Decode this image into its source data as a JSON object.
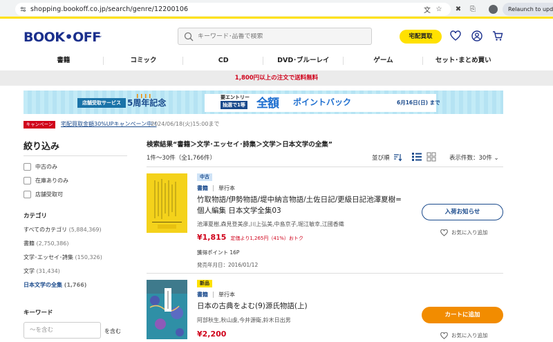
{
  "browser": {
    "url": "shopping.bookoff.co.jp/search/genre/12200106",
    "relaunch_label": "Relaunch to update"
  },
  "header": {
    "logo": "BOOK•OFF",
    "search_placeholder": "キーワード･品番で検索",
    "takuhai_label": "宅配買取"
  },
  "nav": {
    "items": [
      "書籍",
      "コミック",
      "CD",
      "DVD･ブルーレイ",
      "ゲーム",
      "セット･まとめ買い"
    ]
  },
  "shipping_notice": "1,800円以上の注文で送料無料",
  "banner": {
    "left_box": "店舗受取サービス",
    "anniv": "5周年記念",
    "entry_top": "要エントリー",
    "entry_bottom": "抽選で1等",
    "big_text": "全額",
    "big_text2": "ポイントバック",
    "date": "6月16日(日) まで"
  },
  "campaign": {
    "tag": "キャンペーン",
    "link": "宅配買取金額30%UPキャンペーン中!!",
    "date": "2024/06/18(火)15:00まで"
  },
  "sidebar": {
    "title": "絞り込み",
    "filters": [
      "中古のみ",
      "在庫ありのみ",
      "店舗受取可"
    ],
    "category_head": "カテゴリ",
    "categories": [
      {
        "label": "すべてのカテゴリ",
        "count": "(5,884,369)"
      },
      {
        "label": "書籍",
        "count": "(2,750,386)"
      },
      {
        "label": "文学･エッセイ･詩集",
        "count": "(150,326)"
      },
      {
        "label": "文学",
        "count": "(31,434)"
      },
      {
        "label": "日本文学の全集",
        "count": "(1,766)"
      }
    ],
    "keyword_head": "キーワード",
    "keyword_placeholder": "～を含む",
    "keyword_suffix": "を含む"
  },
  "results": {
    "title": "検索結果“書籍＞文学･エッセイ･詩集＞文学＞日本文学の全集”",
    "count": "1件～30件（全1,766件）",
    "sort_label": "並び順",
    "per_page": "表示件数：30件"
  },
  "items": [
    {
      "badge": "中古",
      "kind": "書籍",
      "format": "単行本",
      "title": "竹取物語/伊勢物語/堤中納言物語/土佐日記/更級日記池澤夏樹=個人編集 日本文学全集03",
      "authors": "池澤夏樹,森見登美彦,川上弘美,中島京子,堀江敏幸,江國香織",
      "price": "¥1,815",
      "price_note": "定価より1,265円（41%）おトク",
      "points": "獲得ポイント 16P",
      "release": "発売年月日：2016/01/12",
      "action": "入荷お知らせ",
      "fav": "お気に入り追加"
    },
    {
      "badge": "新品",
      "kind": "書籍",
      "format": "単行本",
      "title": "日本の古典をよむ(9)源氏物語(上)",
      "authors": "阿部秋生,秋山虔,今井源衛,鈴木日出男",
      "price": "¥2,200",
      "action": "カートに追加",
      "fav": "お気に入り追加"
    }
  ]
}
